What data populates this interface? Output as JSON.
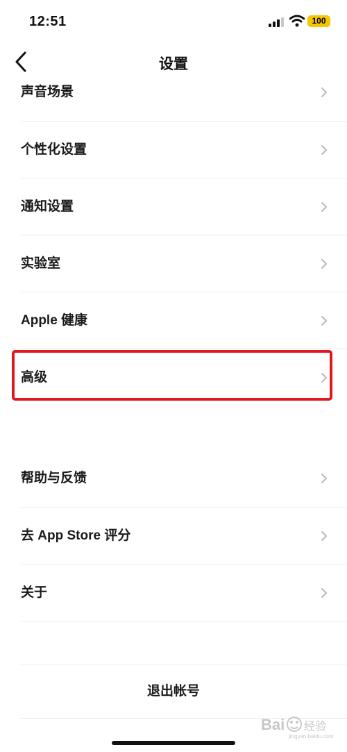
{
  "status": {
    "time": "12:51",
    "battery": "100"
  },
  "header": {
    "title": "设置"
  },
  "settings": {
    "items": [
      {
        "label": "声音场景"
      },
      {
        "label": "个性化设置"
      },
      {
        "label": "通知设置"
      },
      {
        "label": "实验室"
      },
      {
        "label": "Apple 健康"
      },
      {
        "label": "高级"
      }
    ],
    "items2": [
      {
        "label": "帮助与反馈"
      },
      {
        "label": "去 App Store 评分"
      },
      {
        "label": "关于"
      }
    ],
    "logout_label": "退出帐号"
  },
  "colors": {
    "highlight": "#e0181e",
    "battery": "#f6c700"
  },
  "watermark": {
    "text": "Bai 经验"
  }
}
